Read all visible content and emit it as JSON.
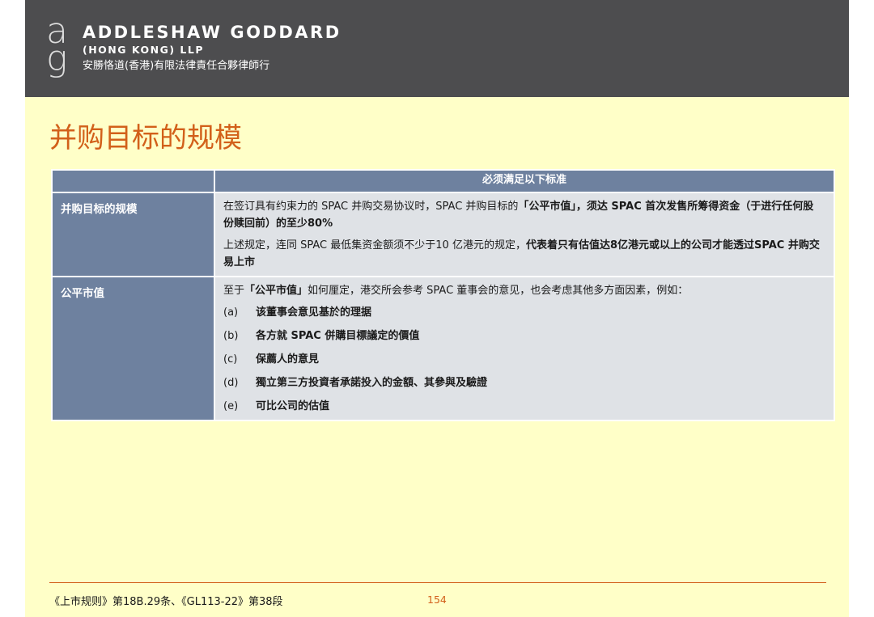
{
  "header": {
    "firm_name": "ADDLESHAW GODDARD",
    "firm_sub": "(HONG KONG) LLP",
    "firm_chinese": "安勝恪道(香港)有限法律責任合夥律師行",
    "logo_letters": [
      "a",
      "g"
    ]
  },
  "title": "并购目标的规模",
  "table": {
    "header": "必须满足以下标准",
    "rows": [
      {
        "label": "并购目标的规模",
        "p1": {
          "normal": "在签订具有约束力的 SPAC 并购交易协议时，SPAC 并购目标的",
          "bold": "「公平市值」，须达 SPAC 首次发售所筹得资金（于进行任何股份赎回前）的至少80%"
        },
        "p2": {
          "normal": "上述规定，连同 SPAC 最低集资金额须不少于10 亿港元的规定，",
          "bold": "代表着只有估值达8亿港元或以上的公司才能透过SPAC 并购交易上市"
        }
      },
      {
        "label": "公平市值",
        "intro": {
          "bold": "「公平市值」",
          "pre": "至于",
          "post": "如何厘定，港交所会参考 SPAC 董事会的意见，也会考虑其他多方面因素，例如："
        },
        "items": [
          {
            "letter": "(a)",
            "text": "该董事会意见基於的理据"
          },
          {
            "letter": "(b)",
            "text": "各方就 SPAC 併購目標議定的價值"
          },
          {
            "letter": "(c)",
            "text": "保薦人的意見"
          },
          {
            "letter": "(d)",
            "text": "獨立第三方投資者承諾投入的金額、其參與及驗證"
          },
          {
            "letter": "(e)",
            "text": "可比公司的估值"
          }
        ]
      }
    ]
  },
  "footer": {
    "reference": "《上市规则》第18B.29条、《GL113-22》第38段",
    "page_number": "154"
  },
  "colors": {
    "header_bg": "#4d4d4f",
    "slide_bg": "#ffffc8",
    "accent": "#d2601a",
    "table_header": "#6e819f",
    "table_cell": "#dfe2e6"
  }
}
